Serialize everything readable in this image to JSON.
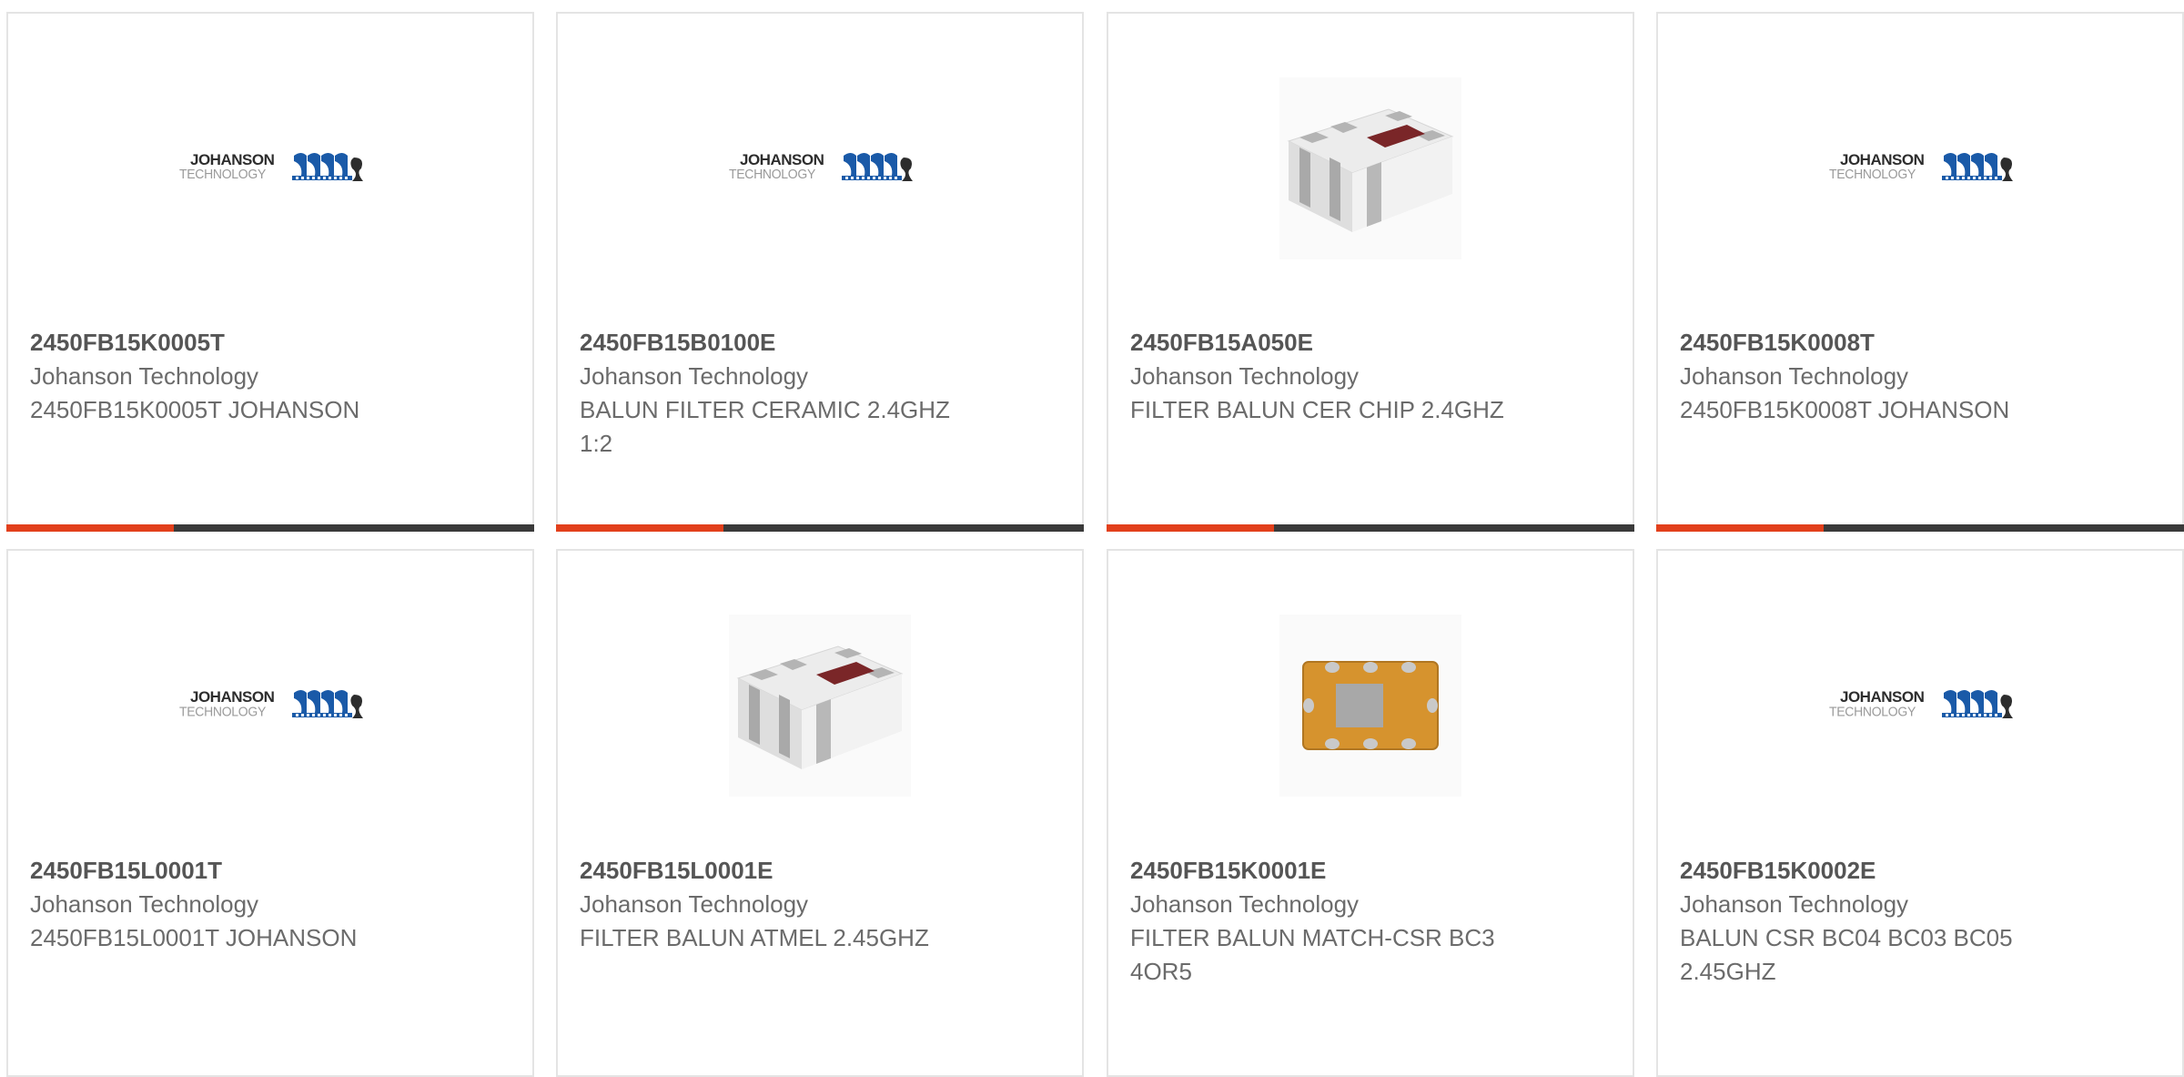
{
  "colors": {
    "accent": "#e2401c",
    "bar_dark": "#3a3a3a",
    "card_border": "#e4e4e4",
    "text": "#6b6b6b"
  },
  "logo": {
    "line1": "JOHANSON",
    "line2": "TECHNOLOGY"
  },
  "products": [
    {
      "part": "2450FB15K0005T",
      "manufacturer": "Johanson Technology",
      "description": "2450FB15K0005T JOHANSON",
      "image": "johanson-logo"
    },
    {
      "part": "2450FB15B0100E",
      "manufacturer": "Johanson Technology",
      "description": "BALUN FILTER CERAMIC 2.4GHZ 1:2",
      "image": "johanson-logo"
    },
    {
      "part": "2450FB15A050E",
      "manufacturer": "Johanson Technology",
      "description": "FILTER BALUN CER CHIP 2.4GHZ",
      "image": "ceramic-chip"
    },
    {
      "part": "2450FB15K0008T",
      "manufacturer": "Johanson Technology",
      "description": "2450FB15K0008T JOHANSON",
      "image": "johanson-logo"
    },
    {
      "part": "2450FB15L0001T",
      "manufacturer": "Johanson Technology",
      "description": "2450FB15L0001T JOHANSON",
      "image": "johanson-logo"
    },
    {
      "part": "2450FB15L0001E",
      "manufacturer": "Johanson Technology",
      "description": "FILTER BALUN ATMEL 2.45GHZ",
      "image": "ceramic-chip"
    },
    {
      "part": "2450FB15K0001E",
      "manufacturer": "Johanson Technology",
      "description": "FILTER BALUN MATCH-CSR BC3 4OR5",
      "image": "amber-chip"
    },
    {
      "part": "2450FB15K0002E",
      "manufacturer": "Johanson Technology",
      "description": "BALUN CSR BC04 BC03 BC05 2.45GHZ",
      "image": "johanson-logo"
    }
  ]
}
